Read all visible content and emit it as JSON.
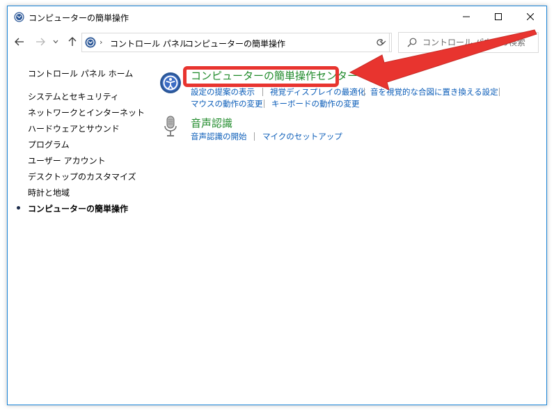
{
  "window": {
    "title": "コンピューターの簡単操作"
  },
  "navigation": {
    "breadcrumb": [
      "コントロール パネル",
      "コンピューターの簡単操作"
    ],
    "search_placeholder": "コントロール パネルの検索"
  },
  "sidebar": {
    "home": "コントロール パネル ホーム",
    "items": [
      "システムとセキュリティ",
      "ネットワークとインターネット",
      "ハードウェアとサウンド",
      "プログラム",
      "ユーザー アカウント",
      "デスクトップのカスタマイズ",
      "時計と地域",
      "コンピューターの簡単操作"
    ],
    "selected_index": 7
  },
  "categories": [
    {
      "title": "コンピューターの簡単操作センター",
      "icon": "ease-of-access-icon",
      "links": [
        "設定の提案の表示",
        "視覚ディスプレイの最適化",
        "音を視覚的な合図に置き換える設定",
        "マウスの動作の変更",
        "キーボードの動作の変更"
      ]
    },
    {
      "title": "音声認識",
      "icon": "microphone-icon",
      "links": [
        "音声認識の開始",
        "マイクのセットアップ"
      ]
    }
  ],
  "colors": {
    "window_border": "#1883d7",
    "link": "#0a5cb8",
    "category_title": "#1f8a2a",
    "annotation_red": "#e8342f"
  }
}
